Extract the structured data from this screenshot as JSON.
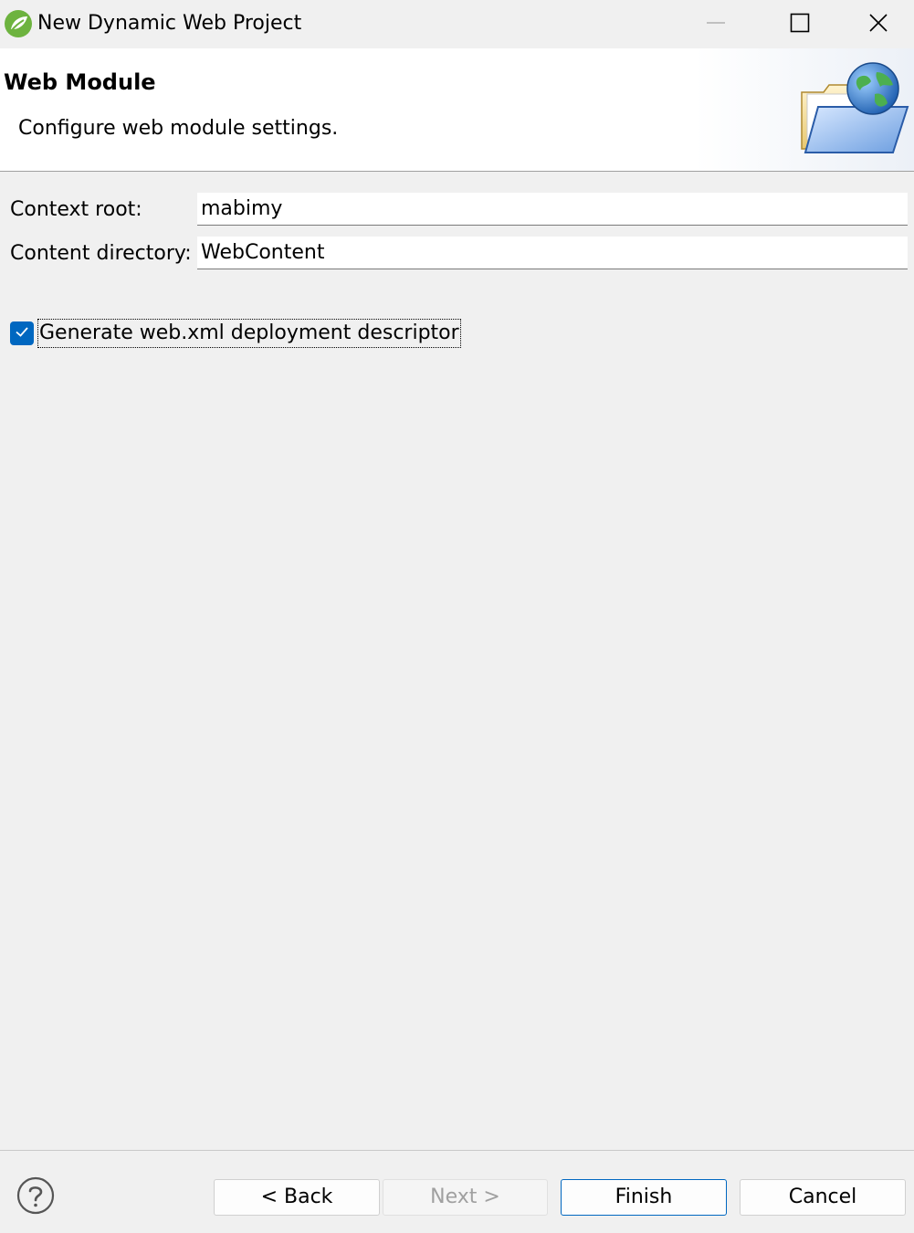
{
  "window": {
    "title": "New Dynamic Web Project",
    "app_icon": "spring-leaf-icon"
  },
  "titlebar_controls": {
    "minimize_icon": "minimize-icon",
    "maximize_icon": "maximize-icon",
    "close_icon": "close-icon"
  },
  "banner": {
    "title": "Web Module",
    "description": "Configure web module settings.",
    "image_icon": "web-folder-globe-icon"
  },
  "form": {
    "context_root_label": "Context root:",
    "context_root_value": "mabimy",
    "content_directory_label": "Content directory:",
    "content_directory_value": "WebContent",
    "generate_webxml_label": "Generate web.xml deployment descriptor",
    "generate_webxml_checked": true
  },
  "footer": {
    "help_icon": "help-icon",
    "back_label": "< Back",
    "next_label": "Next >",
    "finish_label": "Finish",
    "cancel_label": "Cancel"
  },
  "colors": {
    "accent": "#0067c0",
    "background": "#f0f0f0",
    "banner_background": "#ffffff"
  }
}
